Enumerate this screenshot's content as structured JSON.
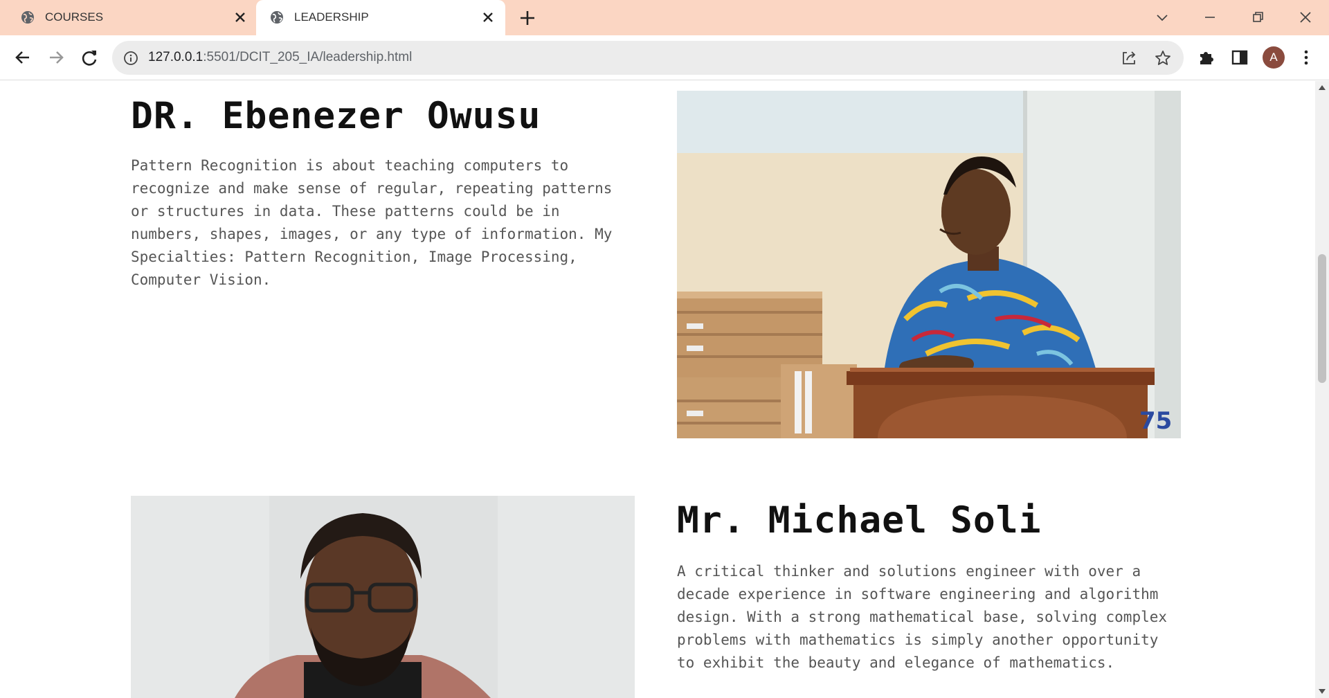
{
  "browser": {
    "tabs": [
      {
        "label": "COURSES",
        "active": false
      },
      {
        "label": "LEADERSHIP",
        "active": true
      }
    ],
    "url_host": "127.0.0.1",
    "url_path": ":5501/DCIT_205_IA/leadership.html",
    "avatar_letter": "A",
    "tab_strip_color": "#fbd6c3"
  },
  "icons": {
    "tab": "globe-icon",
    "close": "close-icon",
    "new_tab": "plus-icon",
    "back": "back-arrow-icon",
    "forward": "forward-arrow-icon",
    "reload": "reload-icon",
    "info": "info-icon",
    "share": "share-icon",
    "bookmark": "star-icon",
    "extensions": "puzzle-icon",
    "side_panel": "side-panel-icon",
    "menu": "kebab-menu-icon"
  },
  "leaders": [
    {
      "name": "DR. Ebenezer Owusu",
      "bio": "Pattern Recognition is about teaching computers to recognize and make sense of regular, repeating patterns or structures in data. These patterns could be in numbers, shapes, images, or any type of information. My Specialties: Pattern Recognition, Image Processing, Computer Vision.",
      "photo_badge": "75"
    },
    {
      "name": "Mr. Michael Soli",
      "bio": "A critical thinker and solutions engineer with over a decade experience in software engineering and algorithm design. With a strong mathematical base, solving complex problems with mathematics is simply another opportunity to exhibit the beauty and elegance of mathematics."
    }
  ]
}
